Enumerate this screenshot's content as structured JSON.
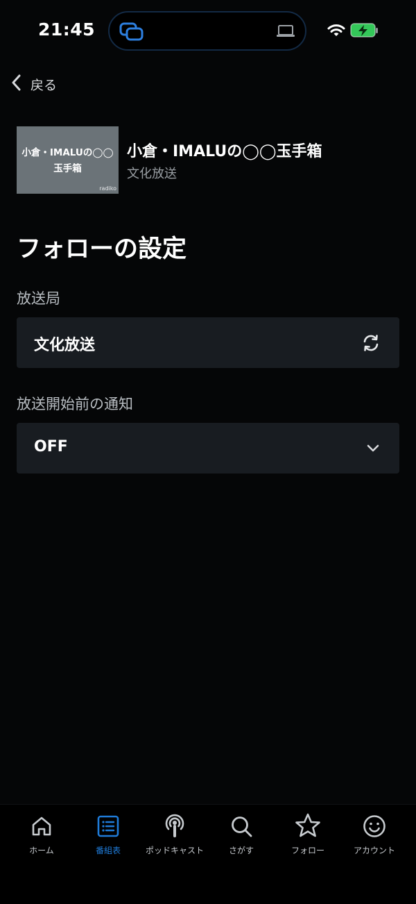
{
  "status_bar": {
    "time": "21:45"
  },
  "back": {
    "label": "戻る"
  },
  "program": {
    "thumbnail_line1": "小倉・IMALUの◯◯",
    "thumbnail_line2": "玉手箱",
    "thumbnail_brand": "radiko",
    "title": "小倉・IMALUの◯◯玉手箱",
    "station": "文化放送"
  },
  "settings": {
    "title": "フォローの設定",
    "station_label": "放送局",
    "station_value": "文化放送",
    "notify_label": "放送開始前の通知",
    "notify_value": "OFF"
  },
  "bottom_nav": {
    "items": [
      {
        "label": "ホーム",
        "icon": "home-icon"
      },
      {
        "label": "番組表",
        "icon": "program-list-icon",
        "active": true
      },
      {
        "label": "ポッドキャスト",
        "icon": "podcast-icon"
      },
      {
        "label": "さがす",
        "icon": "search-icon"
      },
      {
        "label": "フォロー",
        "icon": "star-icon"
      },
      {
        "label": "アカウント",
        "icon": "smiley-icon"
      }
    ]
  },
  "colors": {
    "background": "#050607",
    "field": "#181c21",
    "accent": "#1f7bd8",
    "battery": "#34c759"
  }
}
